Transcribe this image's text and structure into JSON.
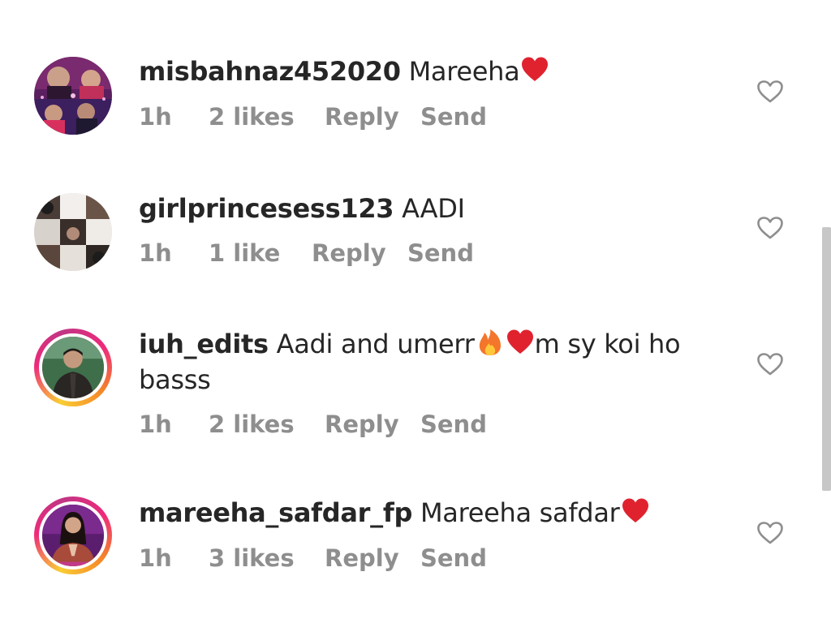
{
  "comments": [
    {
      "username": "misbahnaz452020",
      "message": "Mareeha",
      "time": "1h",
      "likes": "2 likes",
      "reply_label": "Reply",
      "send_label": "Send"
    },
    {
      "username": "girlprincesess123",
      "message": "AADI",
      "time": "1h",
      "likes": "1 like",
      "reply_label": "Reply",
      "send_label": "Send"
    },
    {
      "username": "iuh_edits",
      "message_part1": "Aadi and umerr",
      "message_part2": "m sy koi ho",
      "message_line2": "basss",
      "time": "1h",
      "likes": "2 likes",
      "reply_label": "Reply",
      "send_label": "Send"
    },
    {
      "username": "mareeha_safdar_fp",
      "message": "Mareeha safdar",
      "time": "1h",
      "likes": "3 likes",
      "reply_label": "Reply",
      "send_label": "Send"
    }
  ],
  "icons": {
    "like": "heart-outline-icon",
    "emoji_heart": "red-heart-emoji",
    "emoji_fire": "fire-emoji"
  },
  "colors": {
    "text": "#262626",
    "meta": "#8e8e8e",
    "heart_emoji": "#e0222f",
    "story_ring_start": "#f9ce34",
    "story_ring_mid": "#ee2a7b",
    "story_ring_end": "#c13584"
  }
}
